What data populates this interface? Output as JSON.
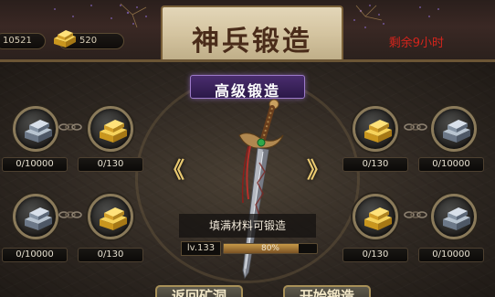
{
  "header": {
    "title": "神兵锻造",
    "remaining_time": "剩余9小时",
    "silver_amount": "10521",
    "gold_amount": "520"
  },
  "forge": {
    "mode_label": "高级锻造",
    "hint": "填满材料可锻造",
    "level": "lv.133",
    "progress_label": "80%",
    "progress_fraction": 0.8,
    "nav_left": "《",
    "nav_right": "》"
  },
  "slots": {
    "left_top_stone": "0/10000",
    "left_top_gold": "0/130",
    "left_bottom_stone": "0/10000",
    "left_bottom_gold": "0/130",
    "right_top_gold": "0/130",
    "right_top_stone": "0/10000",
    "right_bottom_gold": "0/130",
    "right_bottom_stone": "0/10000"
  },
  "buttons": {
    "return_mine": "返回矿洞",
    "start_forge": "开始锻造"
  },
  "colors": {
    "remaining_time": "#d4241c",
    "subtitle_banner": "#4a2d6e",
    "title_plaque": "#d4c4a0"
  }
}
